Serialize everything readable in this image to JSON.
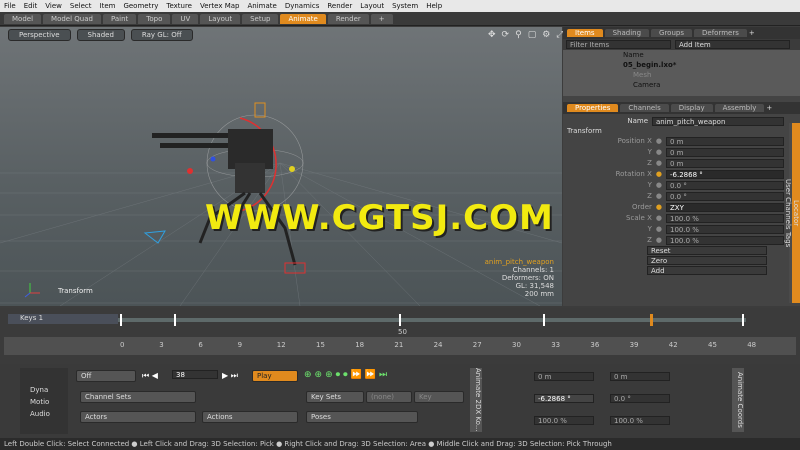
{
  "menu": [
    "File",
    "Edit",
    "View",
    "Select",
    "Item",
    "Geometry",
    "Texture",
    "Vertex Map",
    "Animate",
    "Dynamics",
    "Render",
    "Layout",
    "System",
    "Help"
  ],
  "tabs": [
    "Model",
    "Model Quad",
    "Paint",
    "Topo",
    "UV",
    "Layout",
    "Setup",
    "Animate",
    "Render",
    "+"
  ],
  "viewport": {
    "perspective": "Perspective",
    "shading": "Shaded",
    "raygl": "Ray GL: Off",
    "transform": "Transform",
    "info": [
      "anim_pitch_weapon",
      "Channels: 1",
      "Deformers: ON",
      "GL: 31,548",
      "200 mm"
    ]
  },
  "watermark": "WWW.CGTSJ.COM",
  "items_panel": {
    "tabs": [
      "Items",
      "Shading",
      "Groups",
      "Deformers",
      "+"
    ],
    "filter": "Filter Items",
    "add": "Add Item",
    "name_header": "Name",
    "rows": [
      "05_begin.lxo*",
      "Mesh",
      "Camera"
    ]
  },
  "props": {
    "tabs": [
      "Properties",
      "Channels",
      "Display",
      "Assembly",
      "+"
    ],
    "name_label": "Name",
    "name_value": "anim_pitch_weapon",
    "section": "Transform",
    "position": [
      "Position X",
      "Y",
      "Z"
    ],
    "position_vals": [
      "0 m",
      "0 m",
      "0 m"
    ],
    "rotation": [
      "Rotation X",
      "Y",
      "Z"
    ],
    "rotation_vals": [
      "-6.2868 °",
      "0.0 °",
      "0.0 °"
    ],
    "order_label": "Order",
    "order_value": "ZXY",
    "scale": [
      "Scale X",
      "Y",
      "Z"
    ],
    "scale_vals": [
      "100.0 %",
      "100.0 %",
      "100.0 %"
    ],
    "buttons": [
      "Reset",
      "Zero",
      "Add"
    ],
    "side_tabs": [
      "Locator",
      "User Channels",
      "Tags"
    ]
  },
  "timeline": {
    "keys": "Keys 1",
    "ticks": [
      "0",
      "3",
      "6",
      "9",
      "12",
      "15",
      "18",
      "21",
      "24",
      "27",
      "30",
      "33",
      "36",
      "39",
      "42",
      "45",
      "48"
    ],
    "mid": "50"
  },
  "bottom": {
    "dyna": "Dyna",
    "motion": "Motio",
    "audio": "Audio",
    "off": "Off",
    "frame": "38",
    "play": "Play",
    "channel_sets": "Channel Sets",
    "none": "(none)",
    "key_sets": "Key Sets",
    "key": "Key",
    "actors": "Actors",
    "actions": "Actions",
    "poses": "Poses",
    "rot_x": "-6.2868 °",
    "rot_y": "0.0 °",
    "zero": "0 m",
    "scale_x": "100.0 %",
    "scale_y": "100.0 %",
    "animate_label": "Animate 2DX Ko...",
    "coord_label": "Animate Coords"
  },
  "status": "Left Double Click: Select Connected ● Left Click and Drag: 3D Selection: Pick ● Right Click and Drag: 3D Selection: Area ● Middle Click and Drag: 3D Selection: Pick Through"
}
